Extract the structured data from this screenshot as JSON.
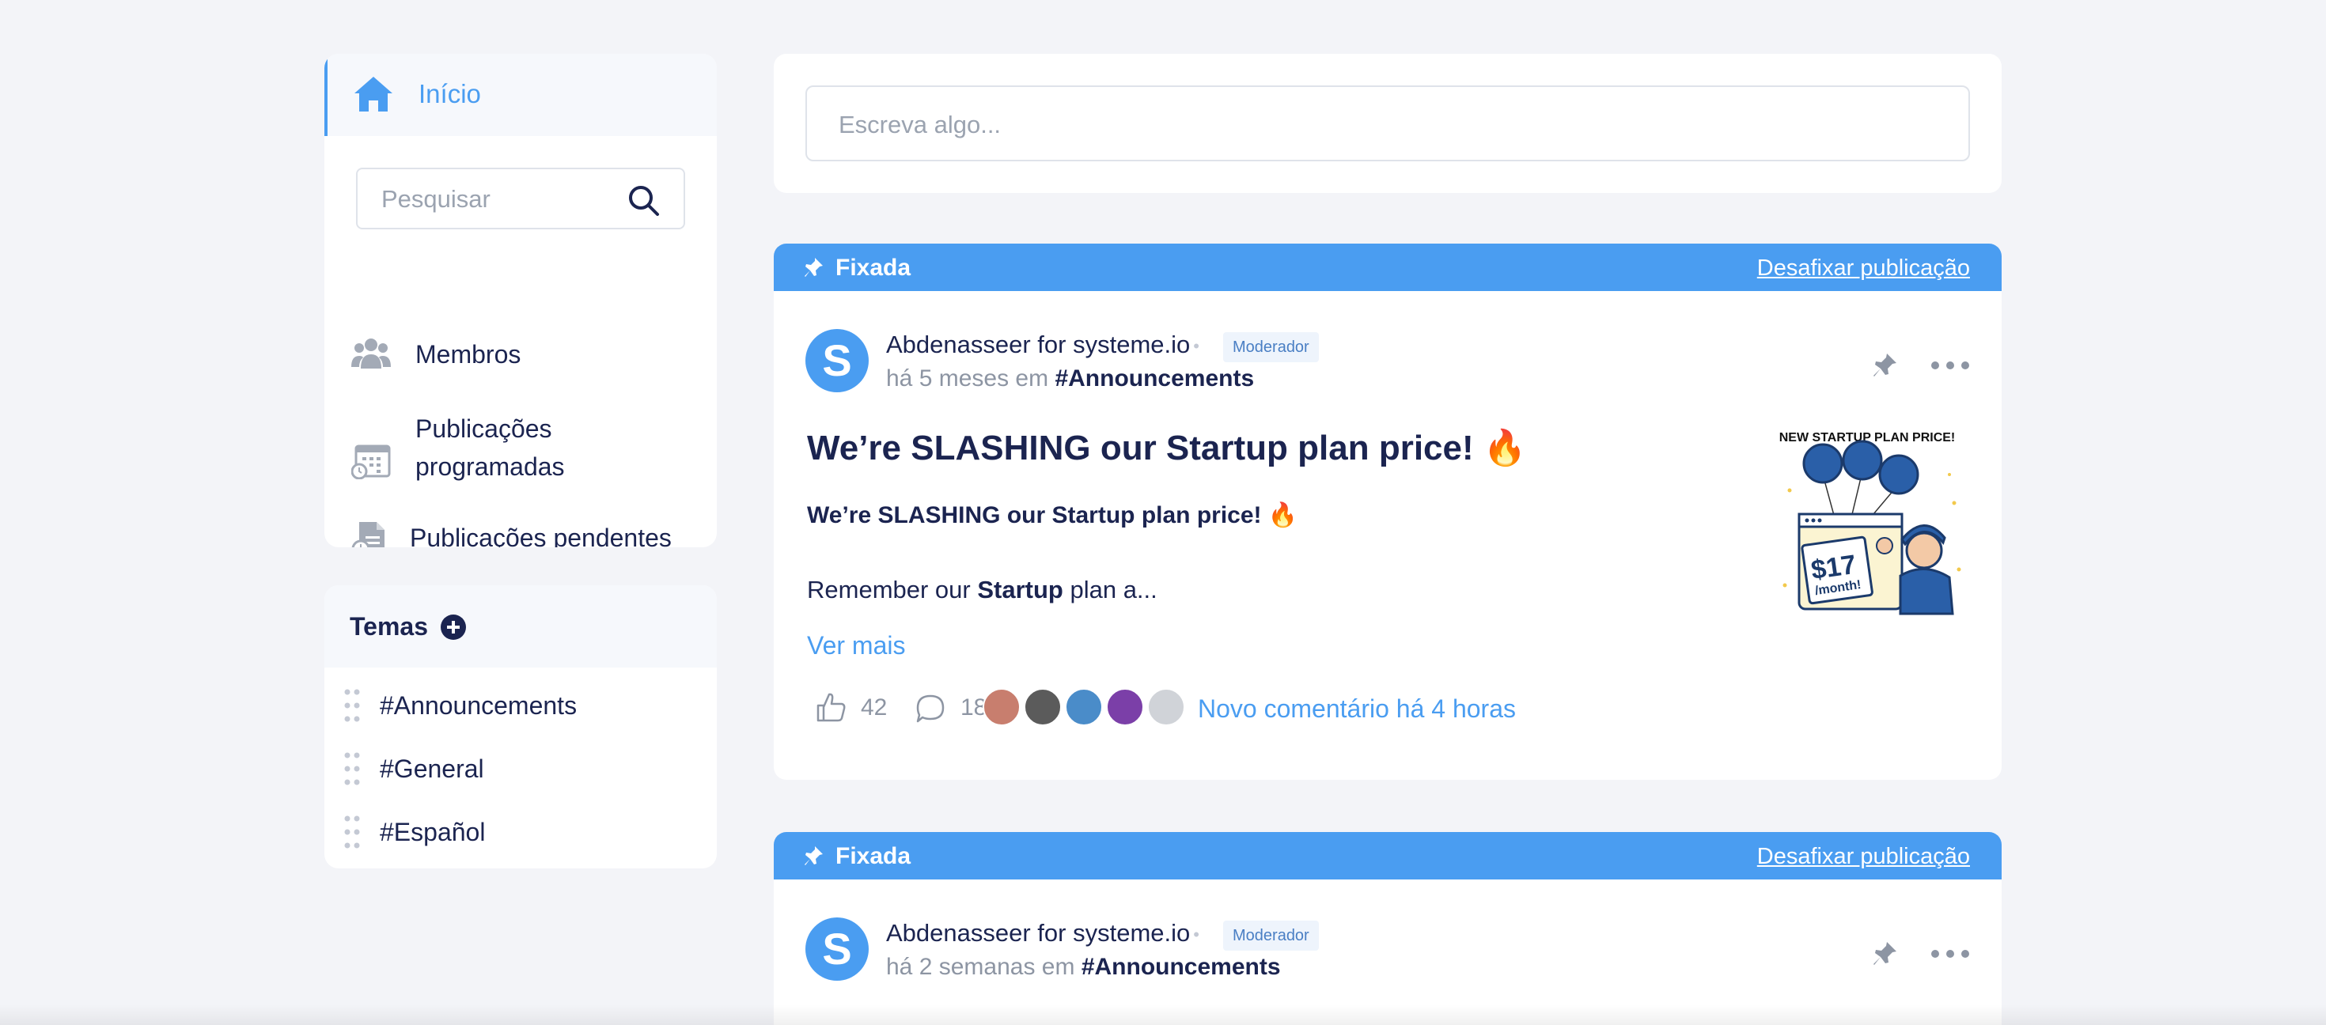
{
  "sidebar": {
    "home_label": "Início",
    "search_placeholder": "Pesquisar",
    "members_label": "Membros",
    "scheduled_label_1": "Publicações",
    "scheduled_label_2": "programadas",
    "pending_label": "Publicações pendentes",
    "themes_title": "Temas",
    "themes": [
      "#Announcements",
      "#General",
      "#Español"
    ]
  },
  "composer": {
    "placeholder": "Escreva algo..."
  },
  "posts": [
    {
      "pinned_label": "Fixada",
      "unpin_label": "Desafixar publicação",
      "avatar_letter": "S",
      "author": "Abdenasseer for systeme.io",
      "badge": "Moderador",
      "time": "há 5 meses em",
      "topic": "#Announcements",
      "title": "We’re SLASHING our Startup plan price! 🔥",
      "subtitle": "We’re SLASHING our Startup plan price! 🔥",
      "body_prefix": "Remember our ",
      "body_bold": "Startup",
      "body_suffix": " plan a...",
      "see_more": "Ver mais",
      "likes": "42",
      "comments": "18",
      "new_comment": "Novo comentário há 4 horas",
      "promo": {
        "headline": "NEW STARTUP PLAN PRICE!",
        "price": "$17",
        "per": "/month!"
      }
    },
    {
      "pinned_label": "Fixada",
      "unpin_label": "Desafixar publicação",
      "avatar_letter": "S",
      "author": "Abdenasseer for systeme.io",
      "badge": "Moderador",
      "time": "há 2 semanas em",
      "topic": "#Announcements"
    }
  ],
  "colors": {
    "accent": "#4a9df1",
    "text": "#1b2450",
    "muted": "#8d95a3",
    "background": "#f3f4f8"
  }
}
